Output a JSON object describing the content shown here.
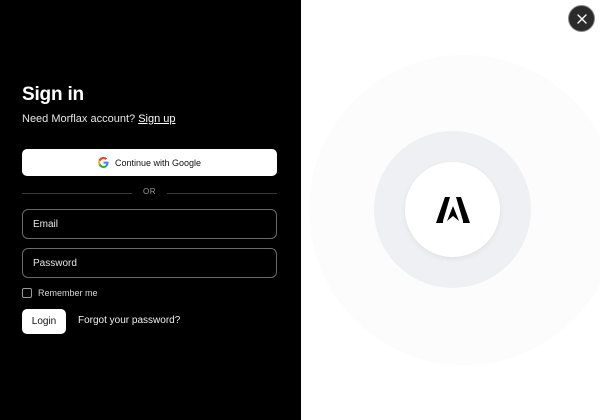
{
  "signin": {
    "title": "Sign in",
    "prompt": "Need Morflax account?",
    "signup_link": "Sign up",
    "google_button": "Continue with Google",
    "divider": "OR",
    "email_placeholder": "Email",
    "email_value": "",
    "password_placeholder": "Password",
    "password_value": "",
    "remember_label": "Remember me",
    "remember_checked": false,
    "login_button": "Login",
    "forgot_link": "Forgot your password?"
  },
  "icons": {
    "close": "close-icon",
    "google": "google-icon",
    "logo": "morflax-logo-icon"
  },
  "colors": {
    "left_panel_bg": "#000000",
    "right_panel_bg": "#ffffff",
    "circle_mid": "#eef0f3",
    "close_button_bg": "#2b2b2b"
  }
}
